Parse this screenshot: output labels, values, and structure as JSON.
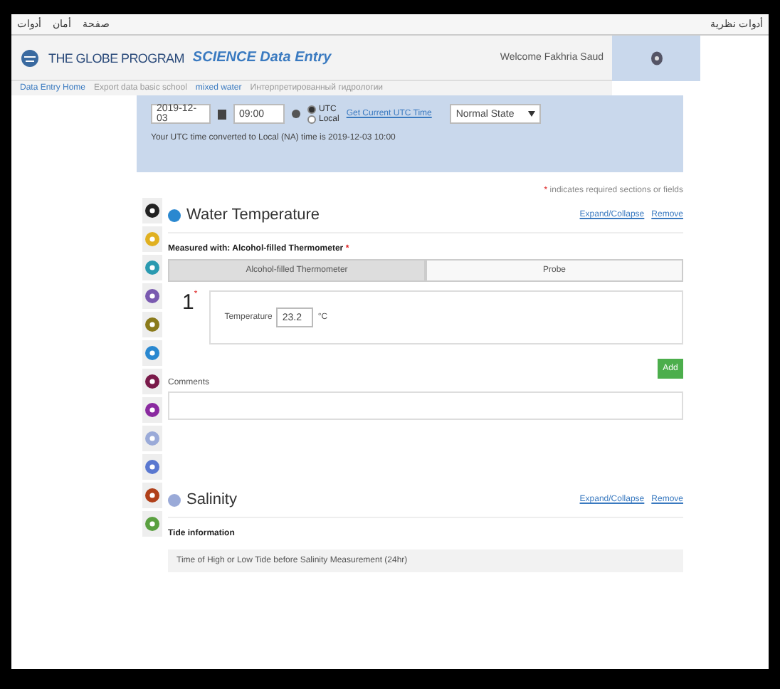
{
  "browser_toolbar": {
    "menus": [
      "صفحة",
      "أمان",
      "أدوات"
    ],
    "right_text": "أدوات نظرية"
  },
  "header": {
    "logo": "THE GLOBE PROGRAM",
    "title": "SCIENCE Data Entry",
    "welcome": "Welcome Fakhria Saud"
  },
  "breadcrumb": [
    {
      "label": "Data Entry Home",
      "link": true
    },
    {
      "label": "Export data basic school",
      "link": false
    },
    {
      "label": "mixed water",
      "link": true
    },
    {
      "label": "Интерпретированный гидрологии",
      "link": false
    }
  ],
  "datetime": {
    "date": "2019-12-03",
    "time": "09:00",
    "zones": [
      {
        "label": "UTC",
        "selected": true
      },
      {
        "label": "Local",
        "selected": false
      }
    ],
    "utc_link": "Get Current UTC Time",
    "state": "Normal State",
    "note": "Your UTC time converted to Local (NA) time is 2019-12-03 10:00"
  },
  "required_note": {
    "mark": "*",
    "text": "indicates required sections or fields"
  },
  "protocols": [
    {
      "color": "#222222"
    },
    {
      "color": "#e0b020"
    },
    {
      "color": "#2a9ab0"
    },
    {
      "color": "#7a5ab0"
    },
    {
      "color": "#8a7a1a"
    },
    {
      "color": "#2a88d0"
    },
    {
      "color": "#7a1a4a"
    },
    {
      "color": "#8a2aa0"
    },
    {
      "color": "#9aaad8"
    },
    {
      "color": "#5a78d0"
    },
    {
      "color": "#b0401a"
    },
    {
      "color": "#5aa040"
    }
  ],
  "water_temperature": {
    "title": "Water Temperature",
    "expand": "Expand/Collapse",
    "remove": "Remove",
    "measured_label": "Measured with: Alcohol-filled Thermometer",
    "required": "*",
    "tabs": [
      {
        "label": "Alcohol-filled Thermometer",
        "selected": true
      },
      {
        "label": "Probe",
        "selected": false
      }
    ],
    "sample_number": "1",
    "sample_mark": "*",
    "temperature_label": "Temperature",
    "temperature": "23.2",
    "unit": "°C",
    "add": "Add",
    "comments_label": "Comments"
  },
  "salinity": {
    "title": "Salinity",
    "expand": "Expand/Collapse",
    "remove": "Remove",
    "tide_label": "Tide information",
    "tide_question": "Time of High or Low Tide before Salinity Measurement (24hr)"
  }
}
